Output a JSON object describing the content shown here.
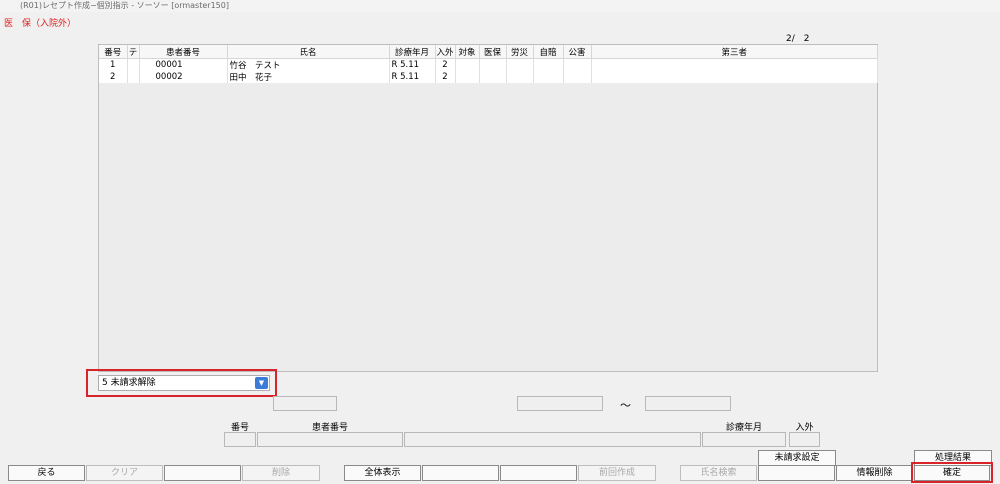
{
  "window": {
    "title": "(R01)レセプト作成−個別指示 - ソーソー [ormaster150]"
  },
  "section": {
    "title": "医　保（入院外）"
  },
  "pager": {
    "text": "2/　2"
  },
  "table": {
    "headers": [
      "番号",
      "テ",
      "患者番号",
      "氏名",
      "診療年月",
      "入外",
      "対象",
      "医保",
      "労災",
      "自賠",
      "公害",
      "第三者"
    ],
    "rows": [
      {
        "no": "1",
        "te": "",
        "patient_no": "00001",
        "name": "竹谷　テスト",
        "ym": "R 5.11",
        "io": "2",
        "target": "",
        "ins": "",
        "rousai": "",
        "jibai": "",
        "kougai": "",
        "third": ""
      },
      {
        "no": "2",
        "te": "",
        "patient_no": "00002",
        "name": "田中　花子",
        "ym": "R 5.11",
        "io": "2",
        "target": "",
        "ins": "",
        "rousai": "",
        "jibai": "",
        "kougai": "",
        "third": ""
      }
    ]
  },
  "mode_select": {
    "value": "5 未請求解除"
  },
  "range": {
    "tilde": "〜"
  },
  "detail_labels": {
    "no": "番号",
    "patient_no": "患者番号",
    "ym": "診療年月",
    "io": "入外"
  },
  "buttons": {
    "mishoukyuu_settei": "未請求設定",
    "shori_kekka": "処理結果",
    "modoru": "戻る",
    "clear": "クリア",
    "sakujo": "削除",
    "zentai_hyouji": "全体表示",
    "zenkai_sakusei": "前回作成",
    "shimei_kensaku": "氏名検索",
    "jouhou_sakujo": "情報削除",
    "kakutei": "確定"
  },
  "colors": {
    "accent_red": "#d8232a",
    "dropdown_blue": "#3d7bd9"
  }
}
